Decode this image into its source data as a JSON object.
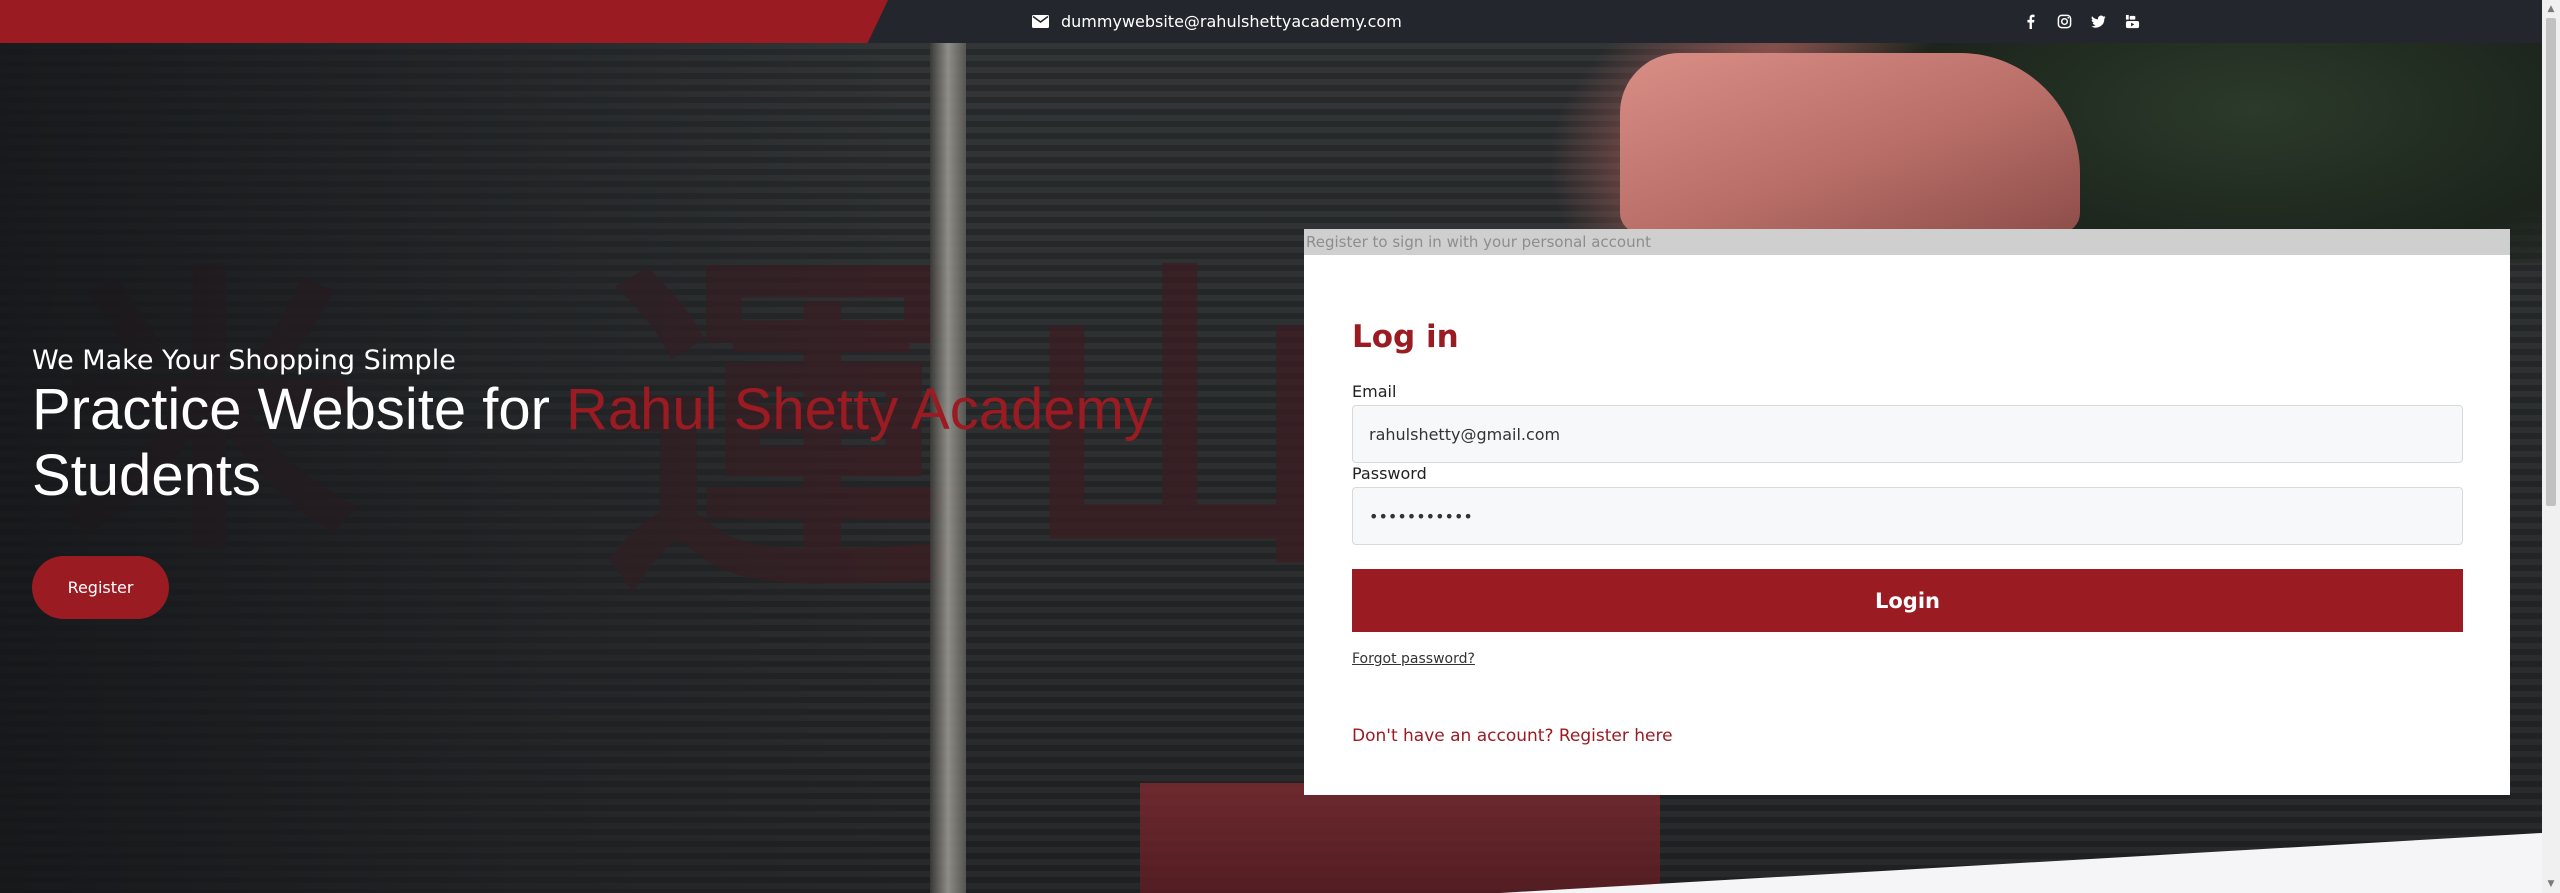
{
  "topbar": {
    "email": "dummywebsite@rahulshettyacademy.com",
    "email_icon": "envelope-icon",
    "socials": [
      "facebook-icon",
      "instagram-icon",
      "twitter-icon",
      "youtube-icon"
    ]
  },
  "hero": {
    "tagline": "We Make Your Shopping Simple",
    "headline_prefix": "Practice Website for ",
    "headline_accent": "Rahul Shetty Academy",
    "headline_suffix": "Students",
    "register_label": "Register"
  },
  "login": {
    "header_note": "Register to sign in with your personal account",
    "title": "Log in",
    "email_label": "Email",
    "email_value": "rahulshetty@gmail.com",
    "password_label": "Password",
    "password_value": "•••••••••••",
    "login_label": "Login",
    "forgot_label": "Forgot password?",
    "register_link": "Don't have an account? Register here"
  },
  "colors": {
    "brand_red": "#9b1b22",
    "topbar_dark": "#24262d"
  }
}
